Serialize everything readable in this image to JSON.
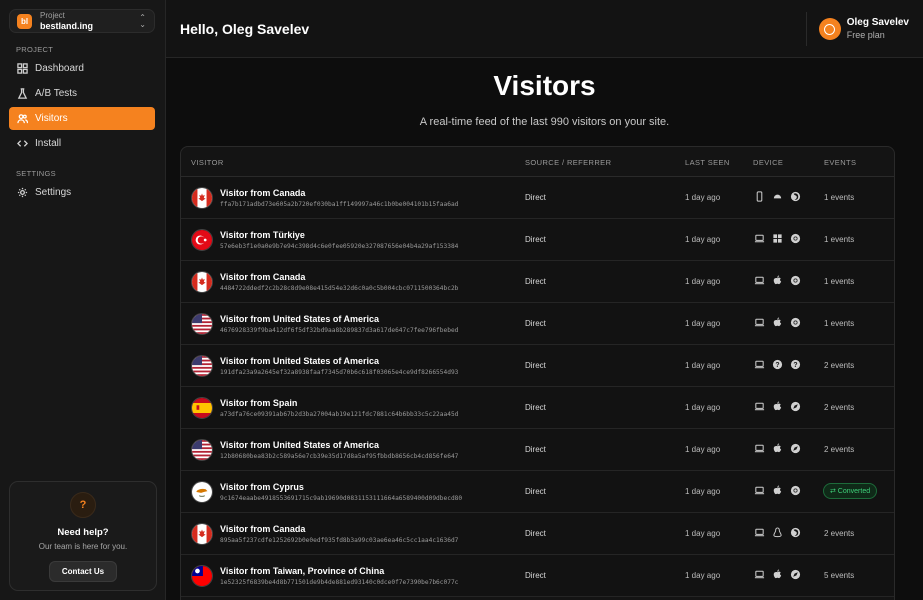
{
  "project": {
    "label": "Project",
    "name": "bestland.ing",
    "logo": "bl"
  },
  "sidebar": {
    "section1": "PROJECT",
    "items": [
      {
        "label": "Dashboard",
        "icon": "dashboard-icon"
      },
      {
        "label": "A/B Tests",
        "icon": "flask-icon"
      },
      {
        "label": "Visitors",
        "icon": "users-icon",
        "active": true
      },
      {
        "label": "Install",
        "icon": "code-icon"
      }
    ],
    "section2": "SETTINGS",
    "settings": {
      "label": "Settings",
      "icon": "gear-icon"
    }
  },
  "help": {
    "title": "Need help?",
    "subtitle": "Our team is here for you.",
    "button": "Contact Us"
  },
  "header": {
    "greeting": "Hello, Oleg Savelev",
    "user_name": "Oleg Savelev",
    "plan": "Free plan"
  },
  "page": {
    "title": "Visitors",
    "subtitle": "A real-time feed of the last 990 visitors on your site."
  },
  "table": {
    "columns": [
      "VISITOR",
      "SOURCE / REFERRER",
      "LAST SEEN",
      "DEVICE",
      "EVENTS"
    ],
    "rows": [
      {
        "name": "Visitor from Canada",
        "hash": "ffa7b171adbd73e605a2b720ef030ba1ff149997a46c1b0be004101b15faa6ad",
        "source": "Direct",
        "seen": "1 day ago",
        "flag": "canada",
        "devices": [
          "phone",
          "android",
          "firefox"
        ],
        "events": "1 events"
      },
      {
        "name": "Visitor from Türkiye",
        "hash": "57e6eb3f1e0a0e9b7e94c398d4c6e0fee05920e327087656e04b4a29af153384",
        "source": "Direct",
        "seen": "1 day ago",
        "flag": "turkey",
        "devices": [
          "laptop",
          "windows",
          "chrome"
        ],
        "events": "1 events"
      },
      {
        "name": "Visitor from Canada",
        "hash": "4484722ddedf2c2b28c8d9e08e415d54e32d6c0a0c5b004cbc0711500364bc2b",
        "source": "Direct",
        "seen": "1 day ago",
        "flag": "canada",
        "devices": [
          "laptop",
          "apple",
          "chrome"
        ],
        "events": "1 events"
      },
      {
        "name": "Visitor from United States of America",
        "hash": "4676928339f9ba412df6f5df32bd9aa8b289837d3a617de647c7fee796fbebed",
        "source": "Direct",
        "seen": "1 day ago",
        "flag": "usa",
        "devices": [
          "laptop",
          "apple",
          "chrome"
        ],
        "events": "1 events"
      },
      {
        "name": "Visitor from United States of America",
        "hash": "191dfa23a9a2645ef32a8938faaf7345d70b6c618f03065e4ce9df8266554d93",
        "source": "Direct",
        "seen": "1 day ago",
        "flag": "usa",
        "devices": [
          "laptop",
          "unknown",
          "unknown"
        ],
        "events": "2 events"
      },
      {
        "name": "Visitor from Spain",
        "hash": "a73dfa76ce09391ab67b2d3ba27004ab19e121fdc7881c64b6bb33c5c22aa45d",
        "source": "Direct",
        "seen": "1 day ago",
        "flag": "spain",
        "devices": [
          "laptop",
          "apple",
          "safari"
        ],
        "events": "2 events"
      },
      {
        "name": "Visitor from United States of America",
        "hash": "12b80680bea83b2c589a56e7cb39e35d17d8a5af95fbbdb8656cb4cd856fe647",
        "source": "Direct",
        "seen": "1 day ago",
        "flag": "usa",
        "devices": [
          "laptop",
          "apple",
          "safari"
        ],
        "events": "2 events"
      },
      {
        "name": "Visitor from Cyprus",
        "hash": "9c1674eaabe4918553691715c9ab19690d0831153111664a6589400d09dbecd80",
        "source": "Direct",
        "seen": "1 day ago",
        "flag": "cyprus",
        "devices": [
          "laptop",
          "apple",
          "chrome"
        ],
        "events": "Converted",
        "converted": true
      },
      {
        "name": "Visitor from Canada",
        "hash": "895aa5f237cdfe1252692b0e0edf935fd8b3a99c03ae6ea46c5cc1aa4c1636d7",
        "source": "Direct",
        "seen": "1 day ago",
        "flag": "canada",
        "devices": [
          "laptop",
          "linux",
          "firefox"
        ],
        "events": "2 events"
      },
      {
        "name": "Visitor from Taiwan, Province of China",
        "hash": "1e52325f6839be4d8b771501de9b4de881ed93140c0dce0f7e7390be7b6c077c",
        "source": "Direct",
        "seen": "1 day ago",
        "flag": "taiwan",
        "devices": [
          "laptop",
          "apple",
          "safari"
        ],
        "events": "5 events"
      }
    ]
  },
  "colors": {
    "accent": "#f5821f",
    "converted": "#3fd17a"
  }
}
